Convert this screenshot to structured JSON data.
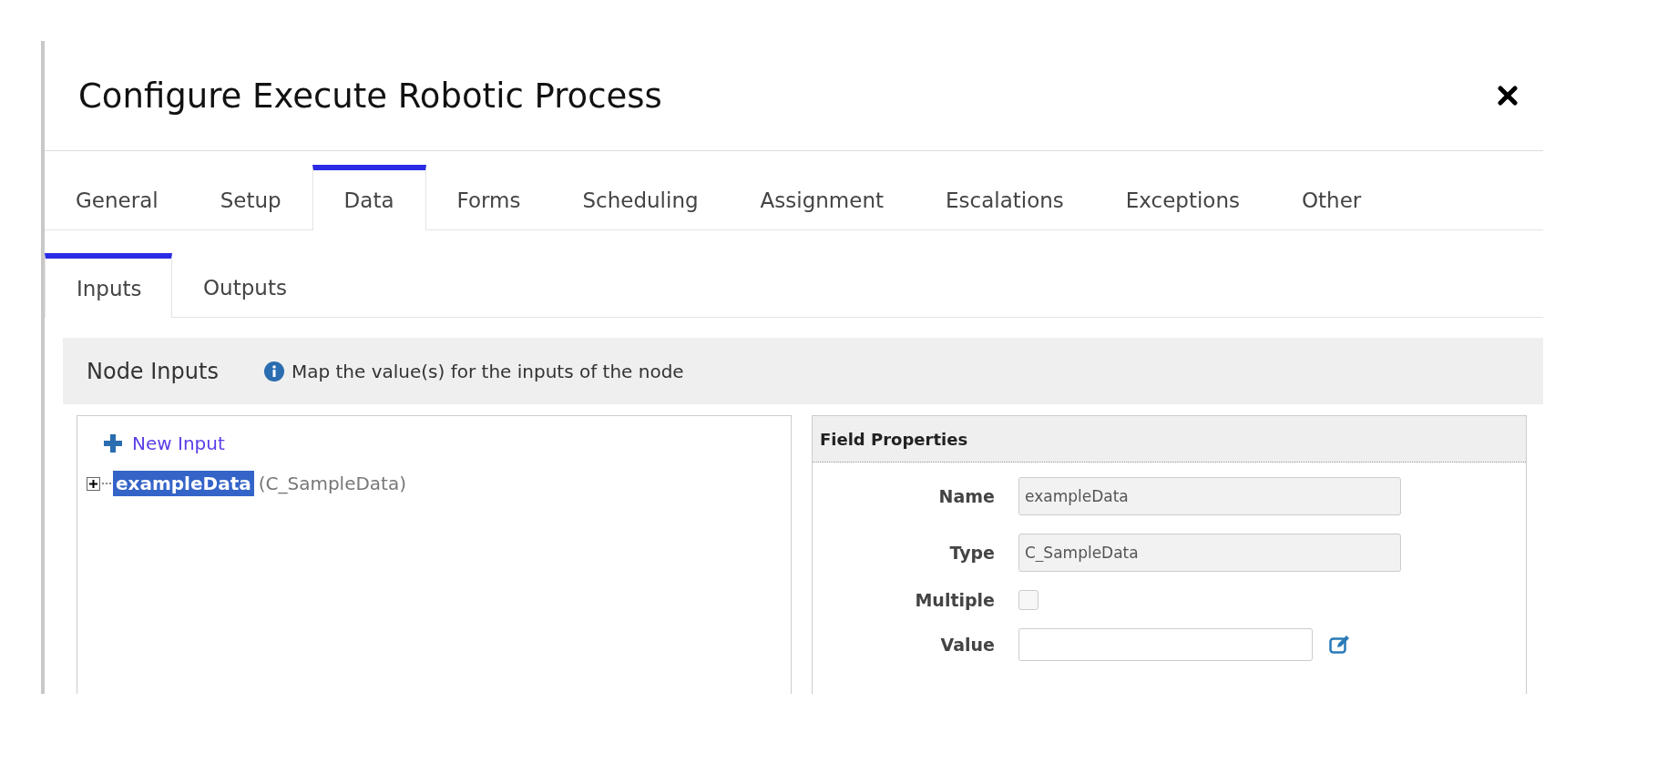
{
  "dialog": {
    "title": "Configure Execute Robotic Process"
  },
  "tabs": [
    {
      "label": "General",
      "selected": false
    },
    {
      "label": "Setup",
      "selected": false
    },
    {
      "label": "Data",
      "selected": true
    },
    {
      "label": "Forms",
      "selected": false
    },
    {
      "label": "Scheduling",
      "selected": false
    },
    {
      "label": "Assignment",
      "selected": false
    },
    {
      "label": "Escalations",
      "selected": false
    },
    {
      "label": "Exceptions",
      "selected": false
    },
    {
      "label": "Other",
      "selected": false
    }
  ],
  "subtabs": [
    {
      "label": "Inputs",
      "selected": true
    },
    {
      "label": "Outputs",
      "selected": false
    }
  ],
  "node_inputs": {
    "title": "Node Inputs",
    "info": "Map the value(s) for the inputs of the node"
  },
  "tree": {
    "new_input": "New Input",
    "items": [
      {
        "name": "exampleData",
        "type": "(C_SampleData)",
        "selected": true,
        "expanded": false
      }
    ]
  },
  "field_properties": {
    "title": "Field Properties",
    "fields": [
      {
        "label": "Name",
        "kind": "input",
        "value": "exampleData",
        "disabled": true
      },
      {
        "label": "Type",
        "kind": "input",
        "value": "C_SampleData",
        "disabled": true
      },
      {
        "label": "Multiple",
        "kind": "checkbox",
        "checked": false
      },
      {
        "label": "Value",
        "kind": "input-with-editor",
        "disabled": false
      }
    ]
  }
}
